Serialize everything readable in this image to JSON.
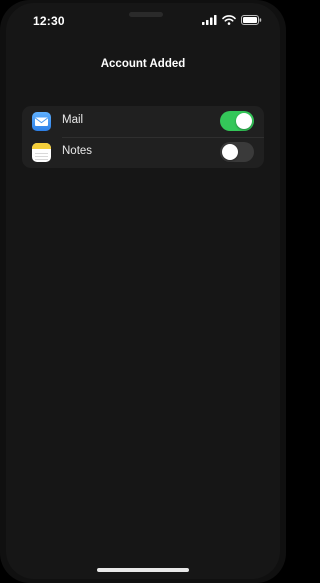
{
  "status_bar": {
    "time": "12:30",
    "icons": [
      "cellular-signal-icon",
      "wifi-icon",
      "battery-icon"
    ]
  },
  "nav": {
    "title": "Account Added"
  },
  "services": [
    {
      "label": "Mail",
      "icon": "mail-icon",
      "enabled": true
    },
    {
      "label": "Notes",
      "icon": "notes-icon",
      "enabled": false
    }
  ],
  "colors": {
    "toggle_on": "#34c759",
    "toggle_off": "#3a3a3a",
    "background": "#161616",
    "group_background": "#202020"
  }
}
